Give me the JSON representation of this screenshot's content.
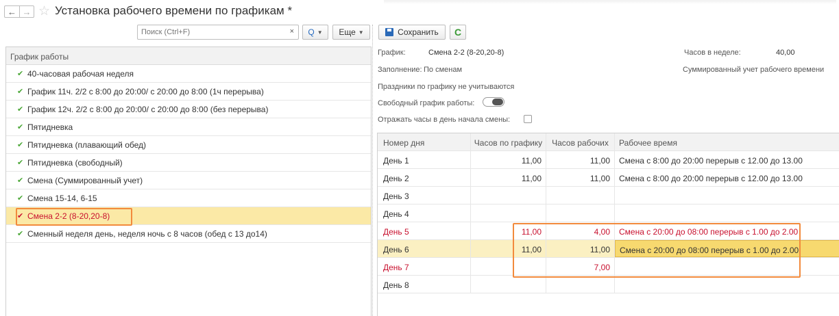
{
  "window": {
    "title": "Установка рабочего времени по графикам *"
  },
  "toolbar_left": {
    "search_placeholder": "Поиск (Ctrl+F)",
    "clear_label": "×",
    "search_button": "Q",
    "more_label": "Еще"
  },
  "schedules": {
    "header": "График работы",
    "items": [
      {
        "label": "40-часовая рабочая неделя"
      },
      {
        "label": "График 11ч. 2/2 с 8:00 до 20:00/ с 20:00 до 8:00 (1ч перерыва)"
      },
      {
        "label": "График 12ч. 2/2 с 8:00 до 20:00/ с 20:00 до 8:00 (без перерыва)"
      },
      {
        "label": "Пятидневка"
      },
      {
        "label": "Пятидневка (плавающий обед)"
      },
      {
        "label": "Пятидневка (свободный)"
      },
      {
        "label": "Смена (Суммированный учет)"
      },
      {
        "label": "Смена 15-14, 6-15"
      },
      {
        "label": "Смена 2-2 (8-20,20-8)"
      },
      {
        "label": "Сменный неделя день, неделя ночь с 8 часов (обед с 13 до14)"
      }
    ],
    "selected_index": 8
  },
  "toolbar_right": {
    "save_label": "Сохранить",
    "refresh_icon": "refresh-icon"
  },
  "info": {
    "schedule_label": "График:",
    "schedule_value": "Смена 2-2 (8-20,20-8)",
    "hours_week_label": "Часов в неделе:",
    "hours_week_value": "40,00",
    "fill_label": "Заполнение:",
    "fill_value": "По сменам",
    "summary_accounting": "Суммированный учет рабочего времени",
    "holidays_note": "Праздники по графику не учитываются",
    "free_schedule_label": "Свободный график работы:",
    "reflect_hours_label": "Отражать часы в день начала смены:"
  },
  "table": {
    "columns": [
      "Номер дня",
      "Часов по графику",
      "Часов рабочих",
      "Рабочее время"
    ],
    "rows": [
      {
        "day": "День 1",
        "scheduled": "11,00",
        "working": "11,00",
        "time": "Смена с 8:00 до 20:00 перерыв с 12.00 до 13.00"
      },
      {
        "day": "День 2",
        "scheduled": "11,00",
        "working": "11,00",
        "time": "Смена с 8:00 до 20:00 перерыв с 12.00 до 13.00"
      },
      {
        "day": "День 3",
        "scheduled": "",
        "working": "",
        "time": ""
      },
      {
        "day": "День 4",
        "scheduled": "",
        "working": "",
        "time": ""
      },
      {
        "day": "День 5",
        "scheduled": "11,00",
        "working": "4,00",
        "time": "Смена с 20:00 до 08:00 перерыв с 1.00 до 2.00"
      },
      {
        "day": "День 6",
        "scheduled": "11,00",
        "working": "11,00",
        "time": "Смена с 20:00 до 08:00 перерыв с 1.00 до 2.00"
      },
      {
        "day": "День 7",
        "scheduled": "",
        "working": "7,00",
        "time": ""
      },
      {
        "day": "День 8",
        "scheduled": "",
        "working": "",
        "time": ""
      }
    ]
  },
  "colors": {
    "highlight_frame": "#f28a3c",
    "selected_row": "#fbe9a6",
    "red_text": "#c8102e",
    "check_green": "#49a635"
  }
}
